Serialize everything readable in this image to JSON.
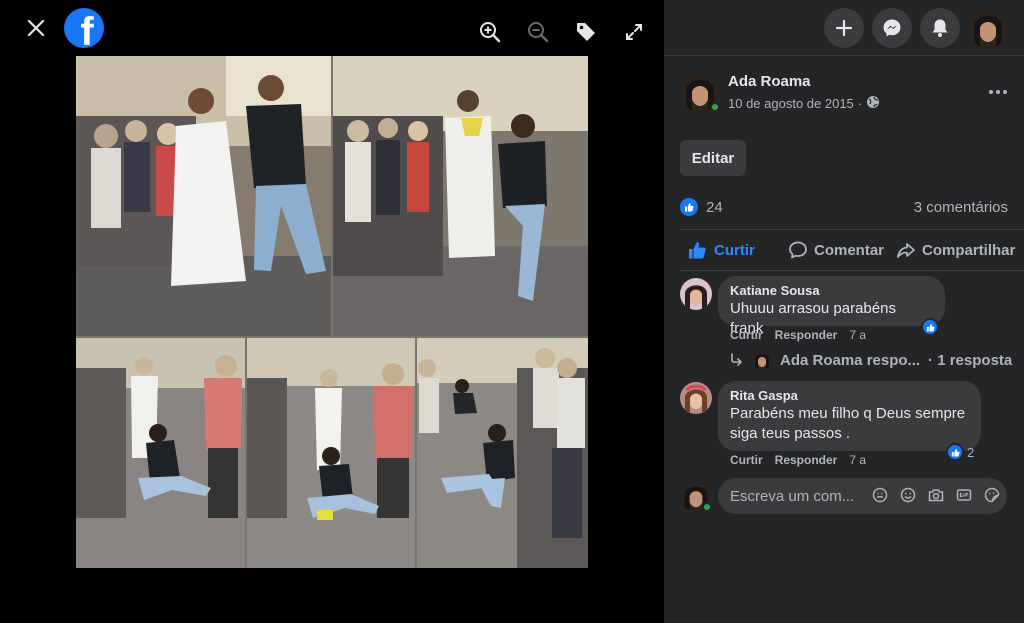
{
  "viewer": {
    "close_icon": "close-icon",
    "logo_letter": "f",
    "tools": [
      "zoom-in-icon",
      "zoom-out-icon",
      "tag-icon",
      "fullscreen-icon"
    ]
  },
  "header": {
    "buttons": [
      "plus-icon",
      "messenger-icon",
      "notifications-icon",
      "profile-avatar"
    ]
  },
  "post": {
    "author": "Ada Roama",
    "date": "10 de agosto de 2015",
    "date_sep": "·",
    "edit_label": "Editar",
    "like_count": "24",
    "comments_count": "3 comentários",
    "actions": {
      "like": "Curtir",
      "comment": "Comentar",
      "share": "Compartilhar"
    }
  },
  "comments": [
    {
      "name": "Katiane Sousa",
      "text": "Uhuuu arrasou parabéns frank",
      "like_label": "Curtir",
      "reply_label": "Responder",
      "time": "7 a",
      "reactions": ""
    },
    {
      "name": "Rita Gaspa",
      "text_line1": "Parabéns meu filho q Deus sempre",
      "text_line2": "siga teus passos .",
      "like_label": "Curtir",
      "reply_label": "Responder",
      "time": "7 a",
      "reactions": "2"
    }
  ],
  "reply_thread": {
    "author_snippet": "Ada Roama respo...",
    "count": "· 1 resposta"
  },
  "composer": {
    "placeholder": "Escreva um com..."
  },
  "colors": {
    "accent": "#2d88ff",
    "panel_bg": "#242526",
    "bubble_bg": "#3a3b3c",
    "brand": "#1877f2"
  }
}
